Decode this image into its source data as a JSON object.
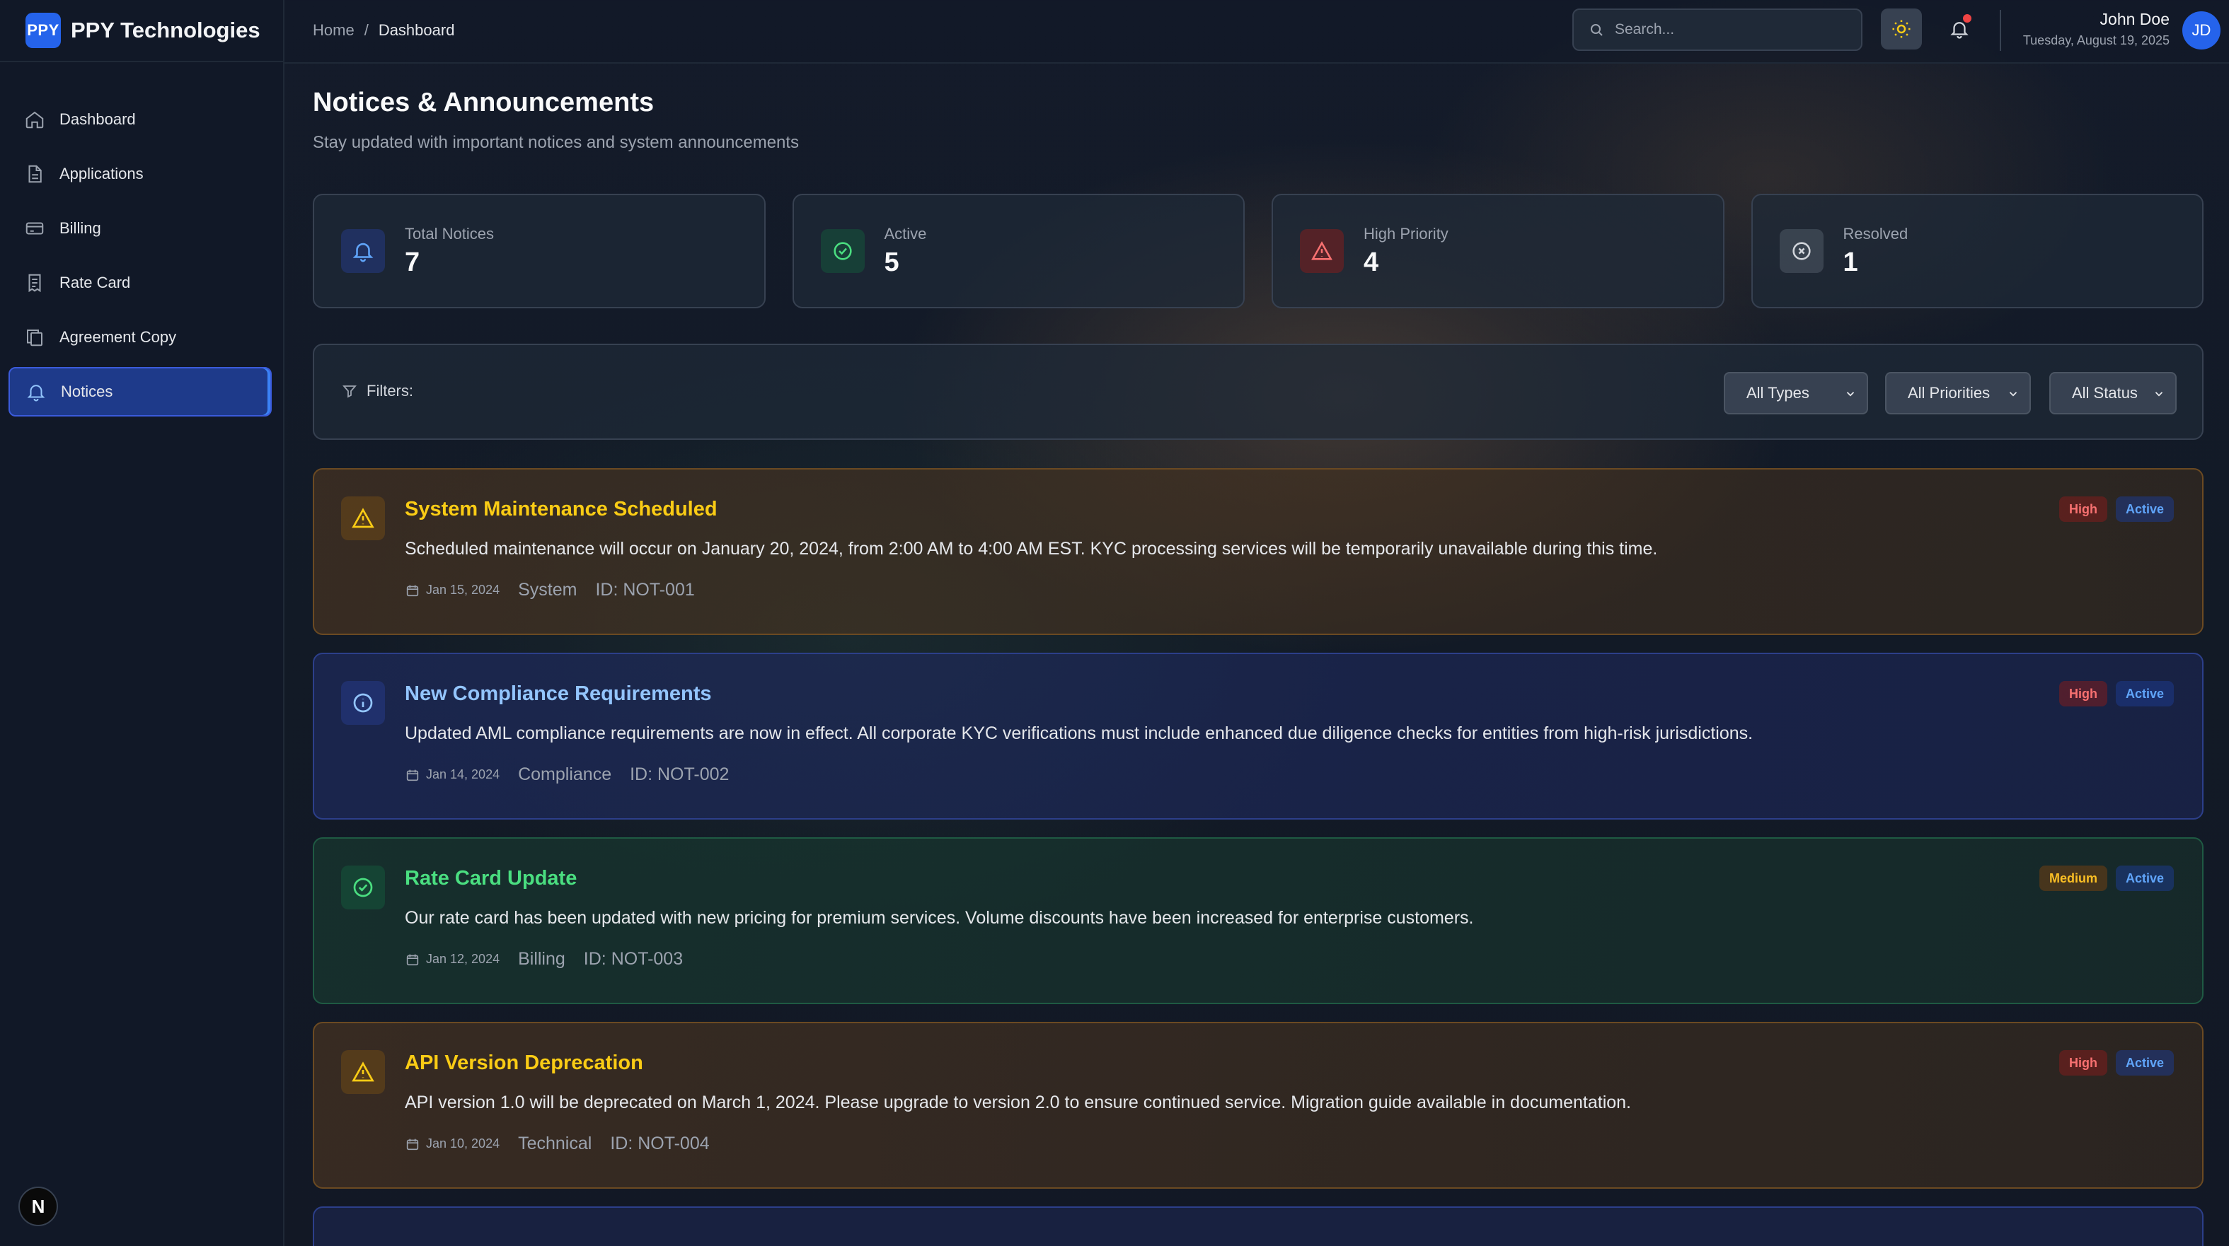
{
  "brand": {
    "logo": "PPY",
    "name": "PPY Technologies"
  },
  "sidebar": {
    "items": [
      {
        "label": "Dashboard",
        "icon": "home-icon"
      },
      {
        "label": "Applications",
        "icon": "file-icon"
      },
      {
        "label": "Billing",
        "icon": "credit-card-icon"
      },
      {
        "label": "Rate Card",
        "icon": "receipt-icon"
      },
      {
        "label": "Agreement Copy",
        "icon": "copy-icon"
      },
      {
        "label": "Notices",
        "icon": "bell-icon",
        "active": true
      }
    ],
    "footer_logo": "N"
  },
  "header": {
    "breadcrumb": [
      "Home",
      "/",
      "Dashboard"
    ],
    "search_placeholder": "Search...",
    "user": {
      "name": "John Doe",
      "date": "Tuesday, August 19, 2025",
      "initials": "JD"
    }
  },
  "page": {
    "title": "Notices & Announcements",
    "subtitle": "Stay updated with important notices and system announcements"
  },
  "stats": [
    {
      "label": "Total Notices",
      "value": "7",
      "icon": "bell-icon",
      "color": "#3b82f6"
    },
    {
      "label": "Active",
      "value": "5",
      "icon": "check-circle-icon",
      "color": "#22c55e"
    },
    {
      "label": "High Priority",
      "value": "4",
      "icon": "alert-triangle-icon",
      "color": "#ef4444"
    },
    {
      "label": "Resolved",
      "value": "1",
      "icon": "x-circle-icon",
      "color": "#9ca3af"
    }
  ],
  "filters": {
    "label": "Filters:",
    "type": "All Types",
    "priority": "All Priorities",
    "status": "All Status"
  },
  "notices": [
    {
      "kind": "warning",
      "title": "System Maintenance Scheduled",
      "body": "Scheduled maintenance will occur on January 20, 2024, from 2:00 AM to 4:00 AM EST. KYC processing services will be temporarily unavailable during this time.",
      "date": "Jan 15, 2024",
      "category": "System",
      "id": "ID: NOT-001",
      "priority": "High",
      "status": "Active"
    },
    {
      "kind": "info",
      "title": "New Compliance Requirements",
      "body": "Updated AML compliance requirements are now in effect. All corporate KYC verifications must include enhanced due diligence checks for entities from high-risk jurisdictions.",
      "date": "Jan 14, 2024",
      "category": "Compliance",
      "id": "ID: NOT-002",
      "priority": "High",
      "status": "Active"
    },
    {
      "kind": "success",
      "title": "Rate Card Update",
      "body": "Our rate card has been updated with new pricing for premium services. Volume discounts have been increased for enterprise customers.",
      "date": "Jan 12, 2024",
      "category": "Billing",
      "id": "ID: NOT-003",
      "priority": "Medium",
      "status": "Active"
    },
    {
      "kind": "warning",
      "title": "API Version Deprecation",
      "body": "API version 1.0 will be deprecated on March 1, 2024. Please upgrade to version 2.0 to ensure continued service. Migration guide available in documentation.",
      "date": "Jan 10, 2024",
      "category": "Technical",
      "id": "ID: NOT-004",
      "priority": "High",
      "status": "Active"
    }
  ]
}
